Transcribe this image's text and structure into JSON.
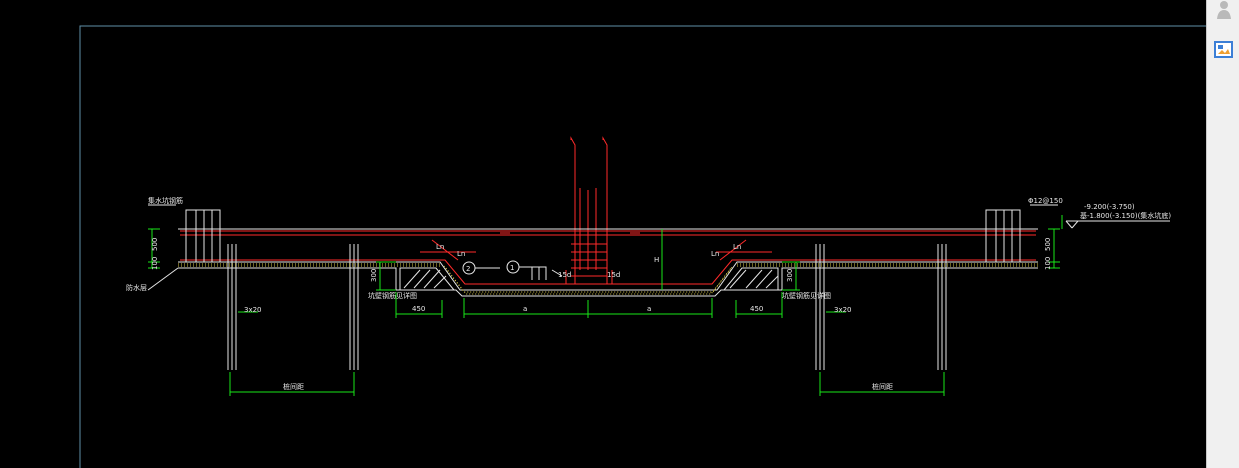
{
  "colors": {
    "background": "#000000",
    "frame": "#5f8fa8",
    "white_lines": "#e6e6e6",
    "red_rebar": "#ff2a2a",
    "green_dims": "#19e619",
    "yellow_gravel": "#d8c84a",
    "panel": "#f0f0f0"
  },
  "sidebar": {
    "items": [
      {
        "icon": "user-pin-icon"
      },
      {
        "icon": "image-tool-icon"
      }
    ]
  },
  "labels": {
    "anchor_left": "Ln",
    "anchor_right": "Ln",
    "lap_left": "Ln",
    "lap_right": "Ln",
    "rebar_15d_left": "15d",
    "rebar_15d_right": "15d",
    "circle_1": "1",
    "circle_2": "2",
    "depth_h": "H",
    "top_left_note": "集水坑钢筋",
    "top_right_note": "Φ12@150",
    "elev_1": "-9.200(-3.750)",
    "elev_2": "基-1.800(-3.150)(集水坑底)",
    "left_side_note": "防水层",
    "left_slope_note": "坑壁钢筋见详图",
    "right_slope_note": "坑壁钢筋见详图",
    "pile_left": "3x20",
    "pile_right": "3x20",
    "pile_spacing_left": "桩间距",
    "pile_spacing_right": "桩间距"
  },
  "dimensions": {
    "left_thickness": "500",
    "left_cushion": "100",
    "right_thickness": "500",
    "right_cushion": "100",
    "left_step": "300",
    "right_step": "300",
    "offset_left": "450",
    "offset_right": "450",
    "half_width_left": "a",
    "half_width_right": "a"
  }
}
